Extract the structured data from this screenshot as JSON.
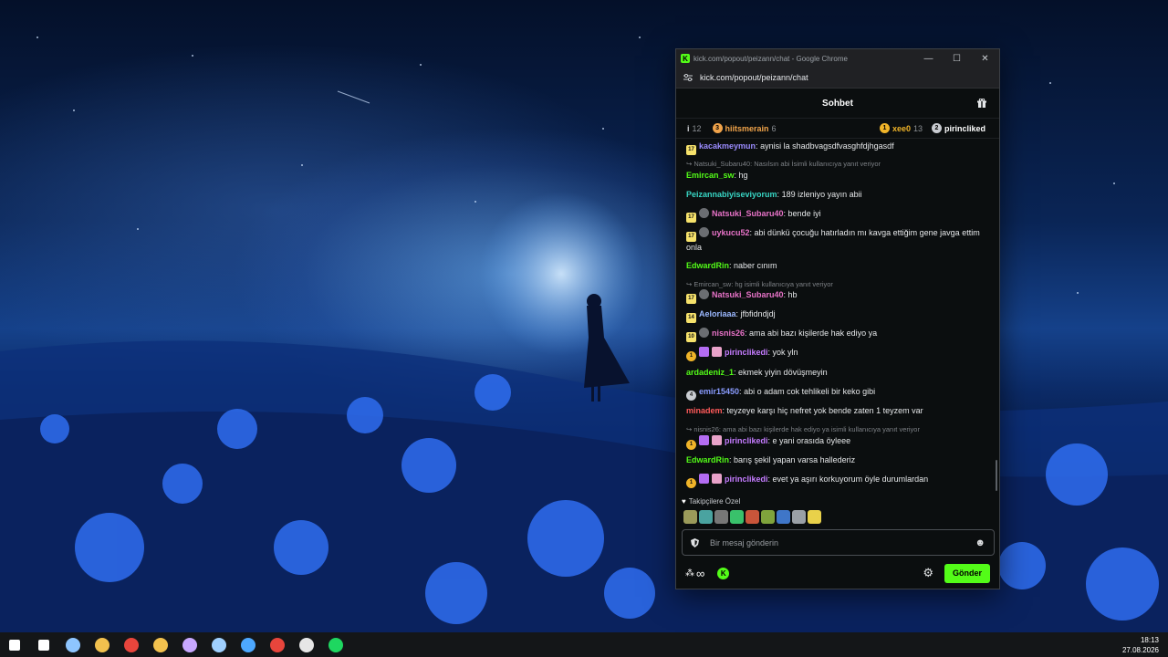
{
  "window": {
    "title": "kick.com/popout/peizann/chat - Google Chrome",
    "url": "kick.com/popout/peizann/chat",
    "minimize": "—",
    "maximize": "☐",
    "close": "✕"
  },
  "chat": {
    "title": "Sohbet",
    "leaderboard": [
      {
        "name": "",
        "count": "12",
        "color": "#cfd2d6",
        "rank": "i"
      },
      {
        "name": "hiitsmerain",
        "count": "6",
        "color": "#f0a34a",
        "rank": "3"
      },
      {
        "name": "xee0",
        "count": "13",
        "color": "#f0b429",
        "rank": "1"
      },
      {
        "name": "pirincliked",
        "count": "",
        "color": "#ffffff",
        "rank": "2"
      }
    ],
    "replies": [
      "↪ Natsuki_Subaru40: Nasılsın abi İsimli kullanıcıya yanıt veriyor",
      "↪ Emircan_sw: hg isimli kullanıcıya yanıt veriyor",
      "↪ nisnis26: ama abi bazı kişilerde hak ediyo ya isimli kullanıcıya yanıt veriyor"
    ],
    "messages": [
      {
        "badges": "17",
        "user": "kacakmeymun",
        "color": "#9b8cff",
        "text": "aynisi la shadbvagsdfvasghfdjhgasdf"
      },
      {
        "badges": "",
        "user": "Emircan_sw",
        "color": "#53fc18",
        "text": "hg"
      },
      {
        "badges": "",
        "user": "Peizannabiyiseviyorum",
        "color": "#38d6c5",
        "text": "189 izleniyo yayın abii"
      },
      {
        "badges": "17",
        "user": "Natsuki_Subaru40",
        "color": "#e873c8",
        "text": "bende iyi"
      },
      {
        "badges": "17",
        "user": "uykucu52",
        "color": "#e873c8",
        "text": "abi dünkü çocuğu hatırladın mı kavga ettiğim gene javga ettim onla"
      },
      {
        "badges": "",
        "user": "EdwardRin",
        "color": "#53fc18",
        "text": "naber cınım"
      },
      {
        "badges": "17",
        "user": "Natsuki_Subaru40",
        "color": "#e873c8",
        "text": "hb"
      },
      {
        "badges": "14",
        "user": "Aeloriaaa",
        "color": "#9bb8ff",
        "text": "jfbfidndjdj"
      },
      {
        "badges": "10",
        "user": "nisnis26",
        "color": "#e873c8",
        "text": "ama abi bazı kişilerde hak ediyo ya"
      },
      {
        "badges": "1",
        "user": "pirinclikedi",
        "color": "#c57cff",
        "text": "yok yln"
      },
      {
        "badges": "",
        "user": "ardadeniz_1",
        "color": "#53fc18",
        "text": "ekmek yiyin dövüşmeyin"
      },
      {
        "badges": "4",
        "user": "emir15450",
        "color": "#8a9cff",
        "text": "abi o adam cok tehlikeli bir keko gibi"
      },
      {
        "badges": "",
        "user": "minadem",
        "color": "#ff5a5a",
        "text": "teyzeye karşı hiç nefret yok bende zaten 1 teyzem var"
      },
      {
        "badges": "1",
        "user": "pirinclikedi",
        "color": "#c57cff",
        "text": "e yani orasıda öyleee"
      },
      {
        "badges": "",
        "user": "EdwardRin",
        "color": "#53fc18",
        "text": "barış şekil yapan varsa hallederiz"
      },
      {
        "badges": "1",
        "user": "pirinclikedi",
        "color": "#c57cff",
        "text": "evet ya aşırı korkuyorum öyle durumlardan"
      }
    ],
    "emote_section": "Takipçilere Özel",
    "emote_names": [
      "pepe-icon",
      "frog-icon",
      "hat-icon",
      "face-icon",
      "green-icon",
      "creature-icon",
      "blue-icon",
      "grumpy-icon",
      "cheese-icon"
    ],
    "emote_colors": [
      "#9a9a5a",
      "#4aa3a0",
      "#777777",
      "#39c16b",
      "#c9553a",
      "#7fa33c",
      "#3f76c8",
      "#9aa0a6",
      "#e9d14a"
    ],
    "input_placeholder": "Bir mesaj gönderin",
    "infinity": "∞",
    "send_label": "Gönder"
  },
  "taskbar": {
    "time": "18:13",
    "date": "27.08.2026",
    "apps": [
      "windows-start-icon",
      "search-icon",
      "taskview-icon",
      "file-explorer-icon",
      "chrome-icon",
      "chrome-profile-icon",
      "chrome-badge-icon",
      "steam-icon",
      "app-icon",
      "browser-red-icon",
      "obs-icon",
      "spotify-icon"
    ],
    "app_colors": [
      "#ffffff",
      "#ffffff",
      "#8ec5ff",
      "#f2c14e",
      "#e8453c",
      "#f2c14e",
      "#c8a8ff",
      "#9fd0ff",
      "#4da8ff",
      "#e8453c",
      "#e6e6e6",
      "#1ed760"
    ]
  }
}
